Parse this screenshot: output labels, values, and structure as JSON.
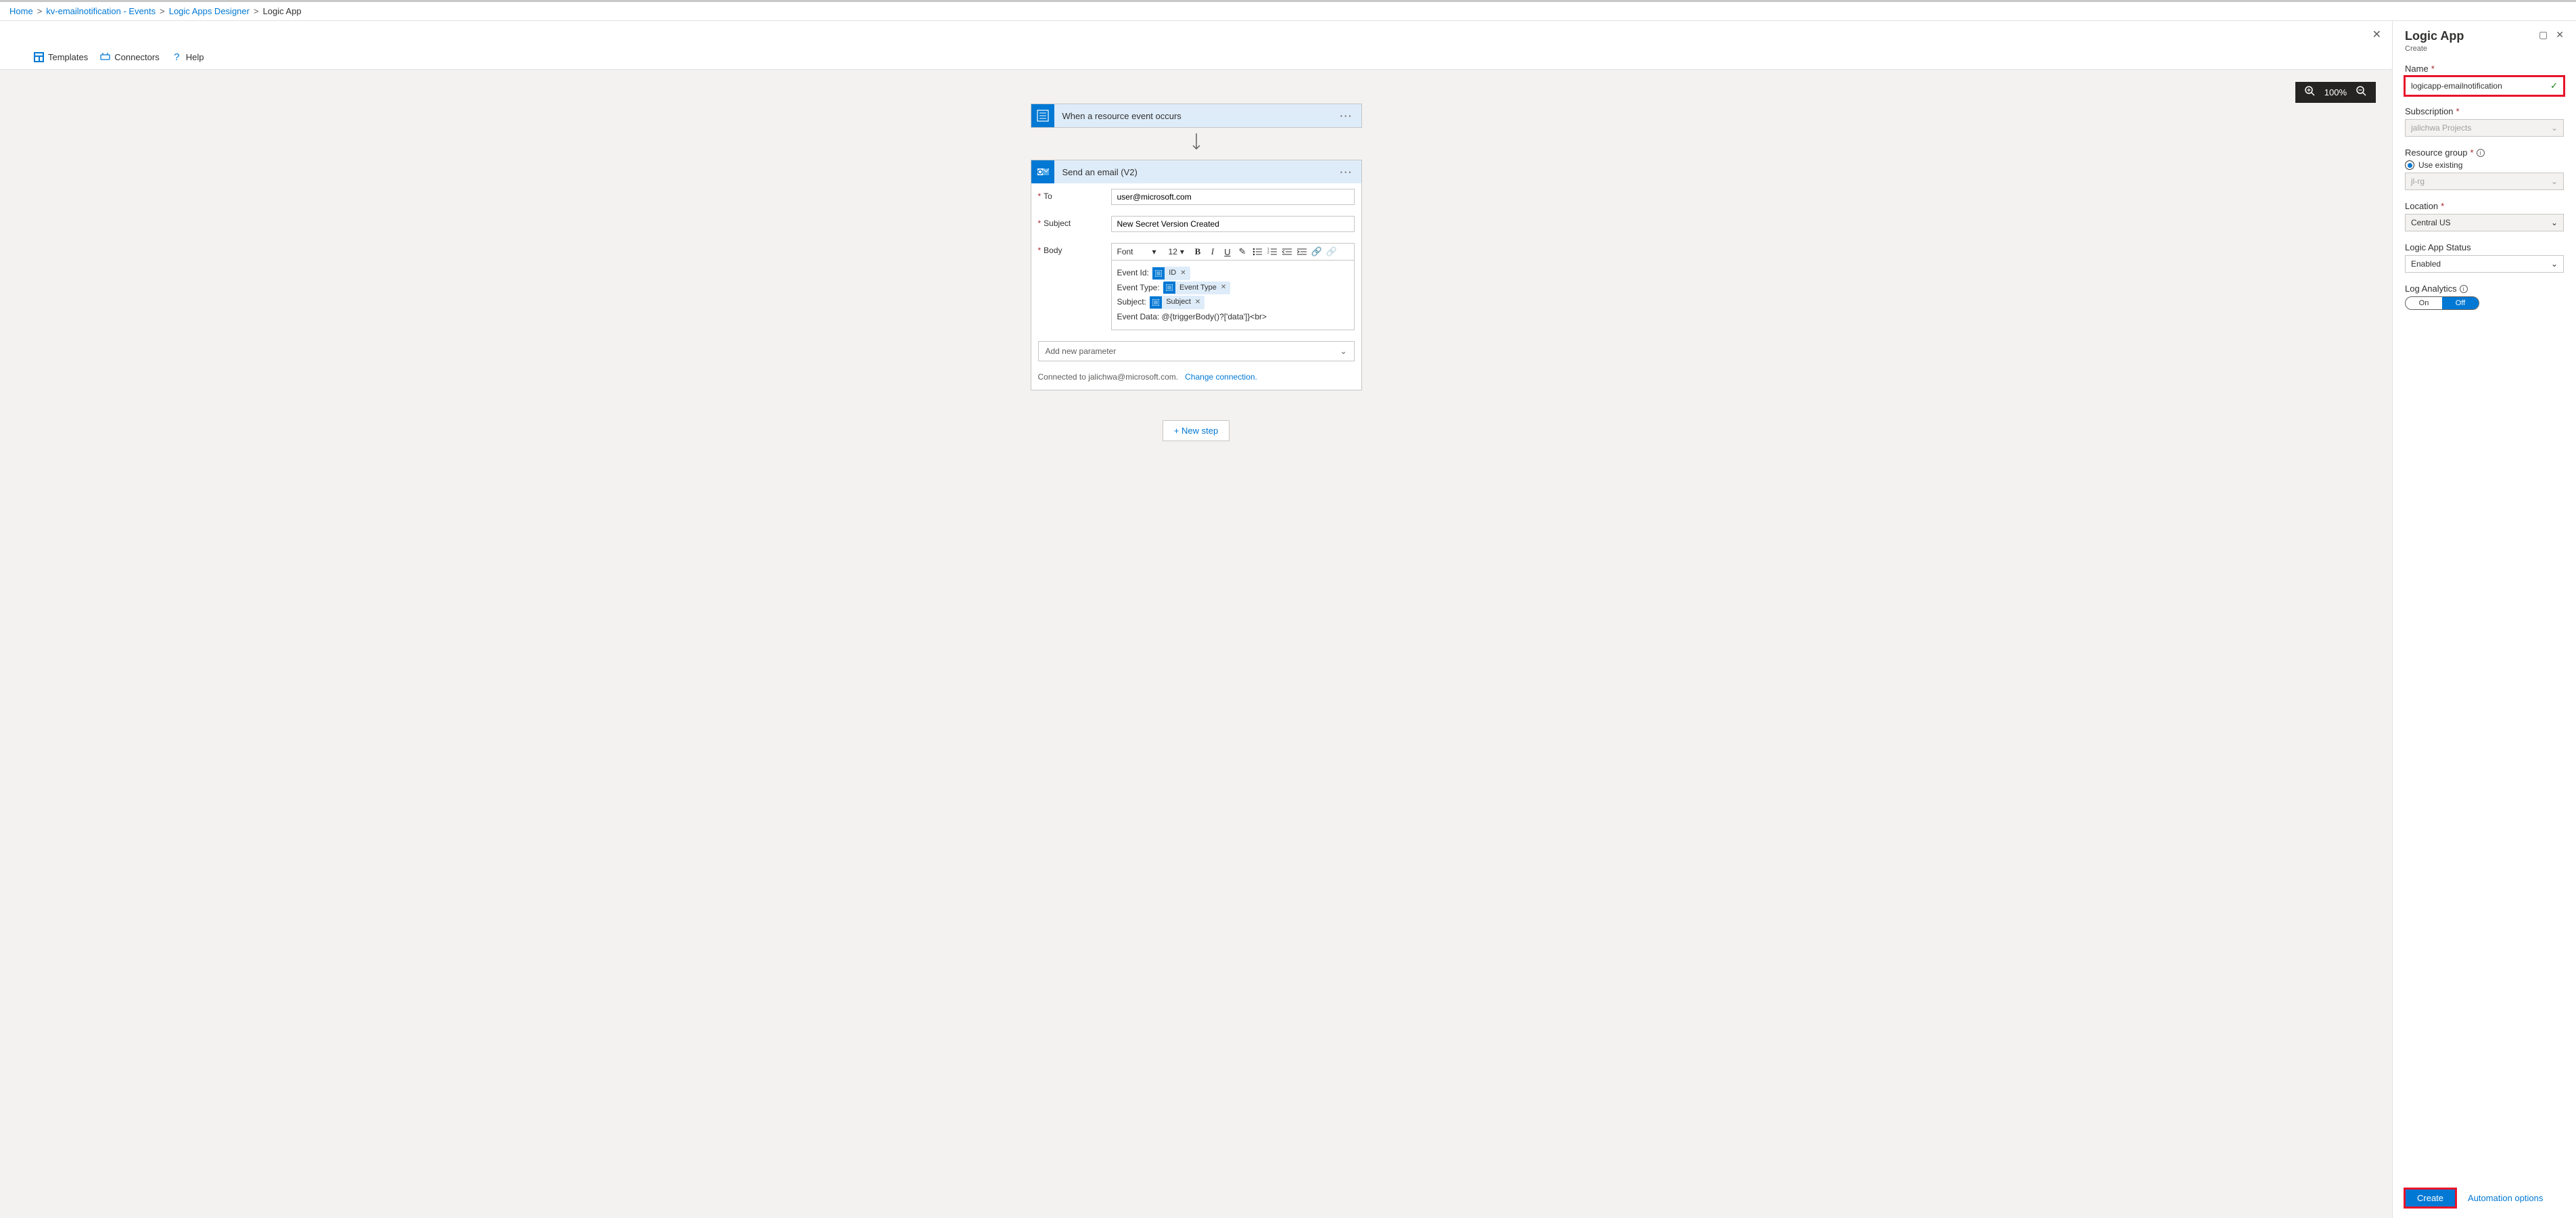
{
  "breadcrumb": {
    "items": [
      "Home",
      "kv-emailnotification - Events",
      "Logic Apps Designer"
    ],
    "current": "Logic App"
  },
  "toolbar": {
    "templates": "Templates",
    "connectors": "Connectors",
    "help": "Help"
  },
  "zoom": "100%",
  "flow": {
    "trigger": {
      "title": "When a resource event occurs"
    },
    "action": {
      "title": "Send an email (V2)",
      "to_label": "To",
      "to_value": "user@microsoft.com",
      "subject_label": "Subject",
      "subject_value": "New Secret Version Created",
      "body_label": "Body",
      "font_sel": "Font",
      "size_sel": "12",
      "body_lines": {
        "l1_label": "Event Id:",
        "l1_token": "ID",
        "l2_label": "Event Type:",
        "l2_token": "Event Type",
        "l3_label": "Subject:",
        "l3_token": "Subject",
        "l4": "Event Data: @{triggerBody()?['data']}<br>"
      },
      "add_param": "Add new parameter",
      "connected": "Connected to jalichwa@microsoft.com.",
      "change_conn": "Change connection."
    },
    "new_step": "+ New step"
  },
  "panel": {
    "title": "Logic App",
    "subtitle": "Create",
    "name_label": "Name",
    "name_value": "logicapp-emailnotification",
    "sub_label": "Subscription",
    "sub_value": "jalichwa Projects",
    "rg_label": "Resource group",
    "rg_option": "Use existing",
    "rg_value": "jl-rg",
    "loc_label": "Location",
    "loc_value": "Central US",
    "status_label": "Logic App Status",
    "status_value": "Enabled",
    "log_label": "Log Analytics",
    "toggle_on": "On",
    "toggle_off": "Off",
    "create": "Create",
    "automation": "Automation options"
  }
}
